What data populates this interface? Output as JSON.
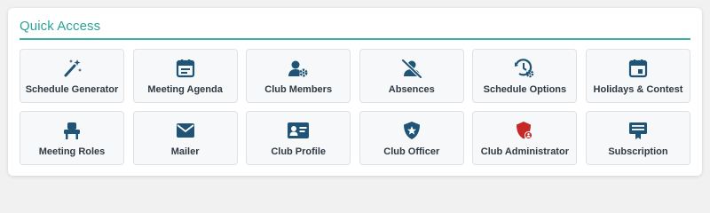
{
  "section": {
    "title": "Quick Access"
  },
  "colors": {
    "accent": "#29a394",
    "icon": "#1f5476",
    "danger": "#c62828"
  },
  "tiles": [
    {
      "label": "Schedule Generator",
      "icon": "magic-wand-icon"
    },
    {
      "label": "Meeting Agenda",
      "icon": "calendar-list-icon"
    },
    {
      "label": "Club Members",
      "icon": "user-gear-icon"
    },
    {
      "label": "Absences",
      "icon": "user-slash-icon"
    },
    {
      "label": "Schedule Options",
      "icon": "clock-gear-icon"
    },
    {
      "label": "Holidays & Contest",
      "icon": "calendar-day-icon"
    },
    {
      "label": "Meeting Roles",
      "icon": "chair-icon"
    },
    {
      "label": "Mailer",
      "icon": "envelope-icon"
    },
    {
      "label": "Club Profile",
      "icon": "id-card-icon"
    },
    {
      "label": "Club Officer",
      "icon": "shield-star-icon"
    },
    {
      "label": "Club Administrator",
      "icon": "shield-user-icon"
    },
    {
      "label": "Subscription",
      "icon": "certificate-icon"
    }
  ]
}
